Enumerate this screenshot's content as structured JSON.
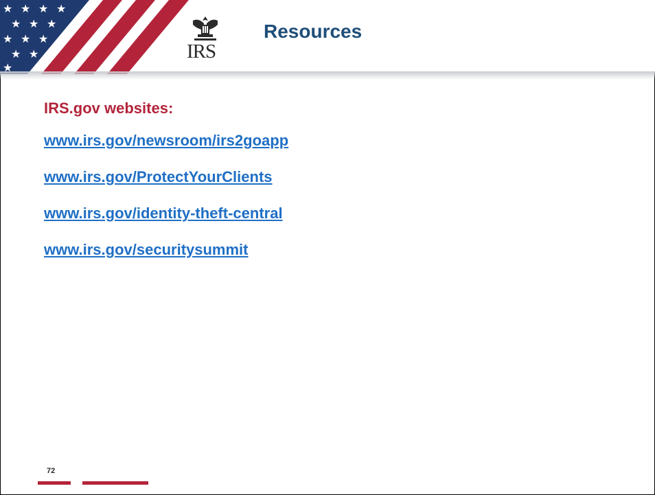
{
  "slide": {
    "title": "Resources",
    "logo_text": "IRS",
    "subheading": "IRS.gov websites:",
    "links": [
      "www.irs.gov/newsroom/irs2goapp",
      "www.irs.gov/ProtectYourClients",
      "www.irs.gov/identity-theft-central",
      "www.irs.gov/securitysummit"
    ],
    "page_number": "72"
  },
  "colors": {
    "title": "#1f4e79",
    "subheading": "#b3243a",
    "link": "#1f6fc5",
    "accent_red": "#b3243a",
    "flag_blue": "#1f3a6e"
  },
  "icons": {
    "flag": "us-flag-graphic",
    "seal": "irs-eagle-seal-icon"
  }
}
